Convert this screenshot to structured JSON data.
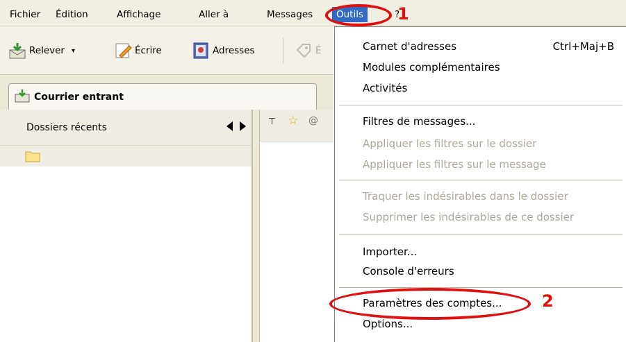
{
  "menubar": {
    "items": [
      {
        "label": "Fichier"
      },
      {
        "label": "Édition"
      },
      {
        "label": "Affichage"
      },
      {
        "label": "Aller à"
      },
      {
        "label": "Messages"
      },
      {
        "label": "Outils"
      },
      {
        "label": "?"
      }
    ]
  },
  "toolbar": {
    "get_label": "Relever",
    "write_label": "Écrire",
    "addresses_label": "Adresses",
    "tag_label": "É"
  },
  "tab": {
    "label": "Courrier entrant"
  },
  "folderpane": {
    "header": "Dossiers récents"
  },
  "tools_menu": {
    "items": [
      {
        "label": "Carnet d'adresses",
        "shortcut": "Ctrl+Maj+B",
        "disabled": false
      },
      {
        "label": "Modules complémentaires",
        "disabled": false
      },
      {
        "label": "Activités",
        "disabled": false
      },
      {
        "label": "Filtres de messages...",
        "disabled": false
      },
      {
        "label": "Appliquer les filtres sur le dossier",
        "disabled": true
      },
      {
        "label": "Appliquer les filtres sur le message",
        "disabled": true
      },
      {
        "label": "Traquer les indésirables dans le dossier",
        "disabled": true
      },
      {
        "label": "Supprimer les indésirables de ce dossier",
        "disabled": true
      },
      {
        "label": "Importer...",
        "disabled": false
      },
      {
        "label": "Console d'erreurs",
        "disabled": false
      },
      {
        "label": "Paramètres des comptes...",
        "disabled": false
      },
      {
        "label": "Options...",
        "disabled": false
      }
    ]
  },
  "annotations": {
    "step1": "1",
    "step2": "2",
    "color": "#e01010"
  },
  "colors": {
    "menu_highlight": "#316ac5",
    "annotation": "#e01010"
  },
  "icons": [
    "get-mail-icon",
    "dropdown-arrow-icon",
    "write-icon",
    "address-book-icon",
    "tag-icon",
    "inbox-icon",
    "folder-icon",
    "thread-icon",
    "star-icon",
    "attachment-icon"
  ]
}
